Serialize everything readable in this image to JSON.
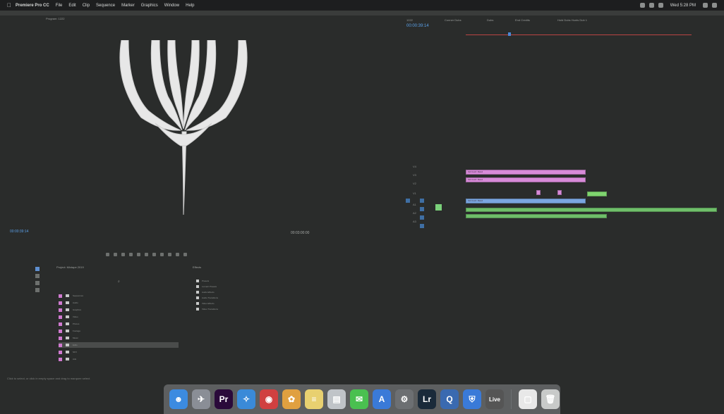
{
  "menubar": {
    "app_name": "Premiere Pro CC",
    "items": [
      "File",
      "Edit",
      "Clip",
      "Sequence",
      "Marker",
      "Graphics",
      "Window",
      "Help"
    ],
    "clock": "Wed 5:28 PM"
  },
  "program_monitor": {
    "tab_label": "Program: 1222",
    "timecode_left": "00:00:39:14",
    "timecode_right": "00:03:00:00"
  },
  "timeline": {
    "timecode": "00:00:39:14",
    "tabs": [
      "1222",
      "Conner Dubs",
      "Dubs",
      "End Credits",
      "Hold Dubs Hunts Dub 1"
    ],
    "track_labels": [
      "V4",
      "V3",
      "V2",
      "V1",
      "A1",
      "A2",
      "A3"
    ],
    "clip_text": "Kid Cudi / Rand"
  },
  "project_panel": {
    "title": "Project: Mixtape 2019",
    "subtitle": "",
    "items": [
      "Sequences",
      "Audio",
      "Graphics",
      "Video",
      "Photos",
      "Footage",
      "Music",
      "Edits",
      "SFX",
      "Ads"
    ]
  },
  "effects_panel": {
    "tab": "Effects",
    "items": [
      "Presets",
      "Lumetri Presets",
      "Audio Effects",
      "Audio Transitions",
      "Video Effects",
      "Video Transitions"
    ]
  },
  "status_bar": {
    "text": "Click to select, or click in empty space and drag to marquee select."
  },
  "dock": {
    "items": [
      {
        "name": "finder",
        "glyph": "☻",
        "color": "#3c8be0"
      },
      {
        "name": "launchpad",
        "glyph": "✈",
        "color": "#8a8e96"
      },
      {
        "name": "premiere",
        "glyph": "Pr",
        "color": "#2a0a3a"
      },
      {
        "name": "safari",
        "glyph": "✧",
        "color": "#3a8ad8"
      },
      {
        "name": "chrome",
        "glyph": "◉",
        "color": "#d04040"
      },
      {
        "name": "photos",
        "glyph": "✿",
        "color": "#e0a040"
      },
      {
        "name": "notes",
        "glyph": "≡",
        "color": "#e8d070"
      },
      {
        "name": "preview",
        "glyph": "▤",
        "color": "#c0c4c8"
      },
      {
        "name": "messages",
        "glyph": "✉",
        "color": "#4ac050"
      },
      {
        "name": "app-store",
        "glyph": "A",
        "color": "#3a7ad8"
      },
      {
        "name": "system-prefs",
        "glyph": "⚙",
        "color": "#6c6f72"
      },
      {
        "name": "lightroom",
        "glyph": "Lr",
        "color": "#1a2a3a"
      },
      {
        "name": "quicktime",
        "glyph": "Q",
        "color": "#3a6ab0"
      },
      {
        "name": "defender",
        "glyph": "⛨",
        "color": "#3a7ad8"
      },
      {
        "name": "live",
        "glyph": "Live",
        "color": "#555"
      },
      {
        "name": "documents",
        "glyph": "▢",
        "color": "#e8e8e8"
      },
      {
        "name": "trash",
        "glyph": "🗑",
        "color": "#c8cac9"
      }
    ]
  },
  "colors": {
    "accent_blue": "#5aa0e8",
    "clip_pink": "#d78ad8",
    "clip_blue": "#7aa6e0",
    "clip_green": "#6fbf6a"
  }
}
